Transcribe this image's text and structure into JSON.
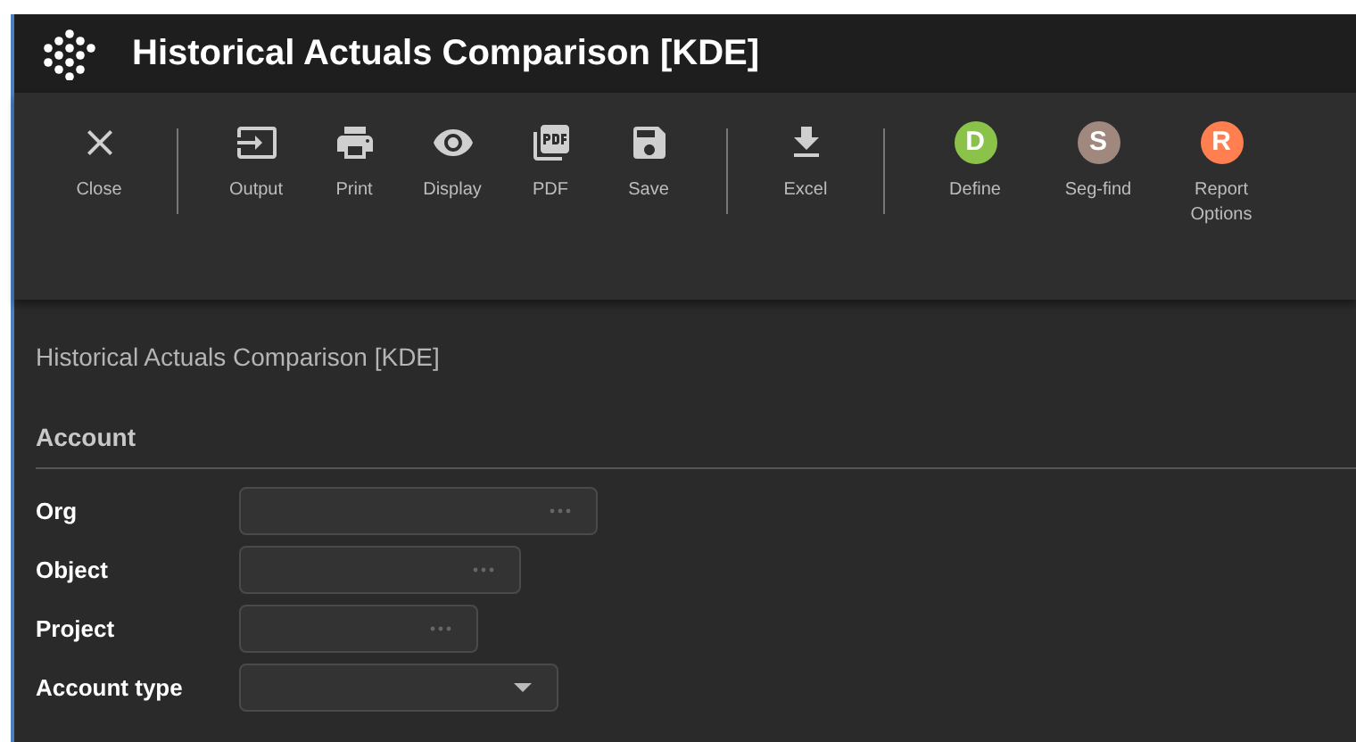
{
  "window": {
    "title": "Historical Actuals Comparison [KDE]"
  },
  "toolbar": [
    {
      "kind": "icon",
      "label": "Close"
    },
    {
      "kind": "separator"
    },
    {
      "kind": "icon",
      "label": "Output"
    },
    {
      "kind": "icon",
      "label": "Print"
    },
    {
      "kind": "icon",
      "label": "Display"
    },
    {
      "kind": "icon",
      "label": "PDF"
    },
    {
      "kind": "icon",
      "label": "Save"
    },
    {
      "kind": "separator"
    },
    {
      "kind": "icon",
      "label": "Excel"
    },
    {
      "kind": "separator"
    },
    {
      "kind": "avatar",
      "letter": "D",
      "color": "#8bc34a",
      "label": "Define"
    },
    {
      "kind": "avatar",
      "letter": "S",
      "color": "#a1887f",
      "label": "Seg-find"
    },
    {
      "kind": "avatar",
      "letter": "R",
      "color": "#ff7f50",
      "label": "Report Options"
    }
  ],
  "page_heading": "Historical Actuals Comparison [KDE]",
  "section": {
    "title": "Account",
    "fields": [
      {
        "label": "Org",
        "kind": "lookup"
      },
      {
        "label": "Object",
        "kind": "lookup"
      },
      {
        "label": "Project",
        "kind": "lookup"
      },
      {
        "label": "Account type",
        "kind": "dropdown"
      }
    ]
  }
}
